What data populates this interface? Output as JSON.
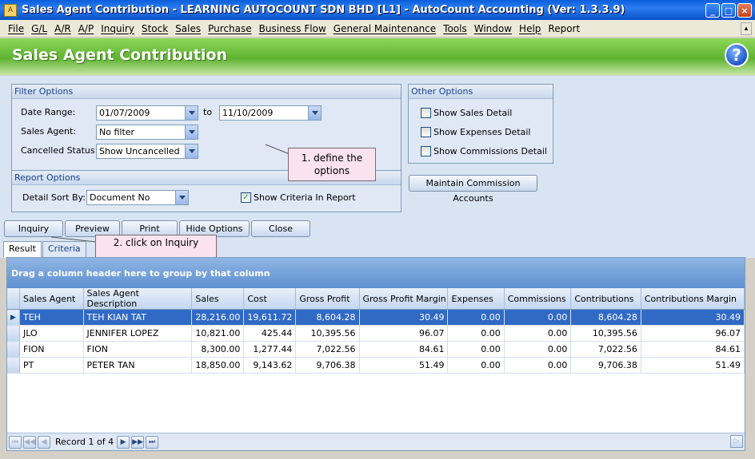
{
  "window": {
    "title": "Sales Agent Contribution - LEARNING AUTOCOUNT SDN BHD [L1] - AutoCount Accounting (Ver: 1.3.3.9)",
    "controls": [
      "_",
      "□",
      "×"
    ]
  },
  "menu": [
    {
      "label": "File",
      "underlined": true
    },
    {
      "label": "G/L",
      "underlined": true
    },
    {
      "label": "A/R",
      "underlined": true
    },
    {
      "label": "A/P",
      "underlined": true
    },
    {
      "label": "Inquiry",
      "underlined": true
    },
    {
      "label": "Stock",
      "underlined": true
    },
    {
      "label": "Sales",
      "underlined": true
    },
    {
      "label": "Purchase",
      "underlined": true
    },
    {
      "label": "Business Flow",
      "underlined": true
    },
    {
      "label": "General Maintenance",
      "underlined": true
    },
    {
      "label": "Tools",
      "underlined": true
    },
    {
      "label": "Window",
      "underlined": true
    },
    {
      "label": "Help",
      "underlined": true
    },
    {
      "label": "Report",
      "underlined": false
    }
  ],
  "header": {
    "title": "Sales Agent Contribution",
    "help_icon": "?"
  },
  "filter_options": {
    "title": "Filter Options",
    "date_range_label": "Date Range:",
    "date_from": "01/07/2009",
    "to_label": "to",
    "date_to": "11/10/2009",
    "sales_agent_label": "Sales Agent:",
    "sales_agent_value": "No filter",
    "cancelled_status_label": "Cancelled Status:",
    "cancelled_status_value": "Show Uncancelled"
  },
  "report_options": {
    "title": "Report Options",
    "detail_sort_label": "Detail Sort By:",
    "detail_sort_value": "Document No",
    "show_criteria_label": "Show Criteria In Report",
    "show_criteria_checked": true
  },
  "other_options": {
    "title": "Other Options",
    "show_sales_detail": "Show Sales Detail",
    "show_expenses_detail": "Show Expenses Detail",
    "show_commissions_detail": "Show Commissions Detail",
    "maintain_button": "Maintain Commission Accounts"
  },
  "actions": {
    "inquiry": "Inquiry",
    "preview": "Preview",
    "print": "Print",
    "hide_options": "Hide Options",
    "close": "Close"
  },
  "callouts": {
    "define": "1. define the options",
    "inquiry": "2. click on Inquiry"
  },
  "tabs": [
    "Result",
    "Criteria"
  ],
  "grid": {
    "group_hint": "Drag a column header here to group by that column",
    "columns": [
      "Sales Agent",
      "Sales Agent Description",
      "Sales",
      "Cost",
      "Gross Profit",
      "Gross Profit Margin",
      "Expenses",
      "Commissions",
      "Contributions",
      "Contributions Margin"
    ],
    "rows": [
      [
        "TEH",
        "TEH KIAN TAT",
        "28,216.00",
        "19,611.72",
        "8,604.28",
        "30.49",
        "0.00",
        "0.00",
        "8,604.28",
        "30.49"
      ],
      [
        "JLO",
        "JENNIFER LOPEZ",
        "10,821.00",
        "425.44",
        "10,395.56",
        "96.07",
        "0.00",
        "0.00",
        "10,395.56",
        "96.07"
      ],
      [
        "FION",
        "FION",
        "8,300.00",
        "1,277.44",
        "7,022.56",
        "84.61",
        "0.00",
        "0.00",
        "7,022.56",
        "84.61"
      ],
      [
        "PT",
        "PETER TAN",
        "18,850.00",
        "9,143.62",
        "9,706.38",
        "51.49",
        "0.00",
        "0.00",
        "9,706.38",
        "51.49"
      ]
    ],
    "selected_row": 0
  },
  "navigator": {
    "record_text": "Record 1 of 4"
  }
}
